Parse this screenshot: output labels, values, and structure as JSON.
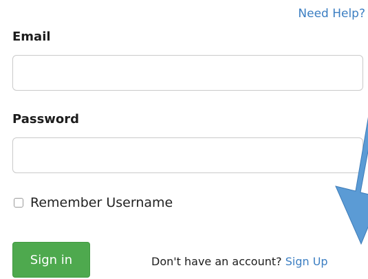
{
  "header": {
    "help_link": "Need Help?"
  },
  "form": {
    "email_label": "Email",
    "email_value": "",
    "password_label": "Password",
    "password_value": "",
    "remember_label": "Remember Username",
    "remember_checked": false,
    "signin_label": "Sign in",
    "signup_prompt": "Don't have an account?",
    "signup_link": "Sign Up"
  },
  "annotation": {
    "arrow_color": "#5b9bd5",
    "arrow_stroke": "#3e7cb8"
  },
  "colors": {
    "link": "#3b7ec2",
    "signin_button": "#4ea94e"
  }
}
